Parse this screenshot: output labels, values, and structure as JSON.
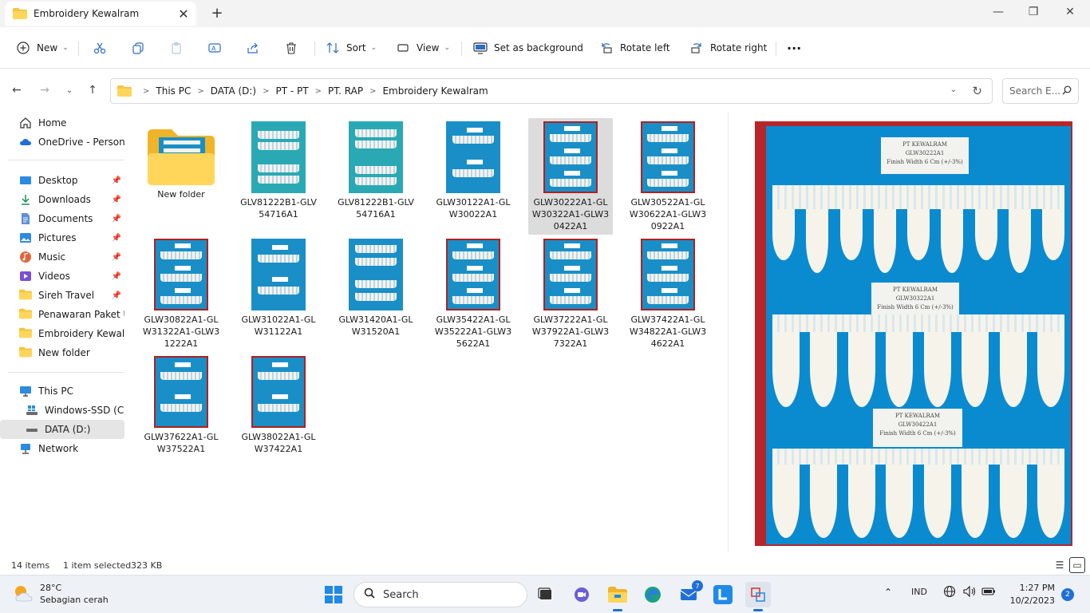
{
  "window": {
    "tab_title": "Embroidery Kewalram",
    "minimize": "—",
    "maximize": "❐",
    "close": "✕"
  },
  "toolbar": {
    "new_label": "New",
    "sort_label": "Sort",
    "view_label": "View",
    "set_background_label": "Set as background",
    "rotate_left_label": "Rotate left",
    "rotate_right_label": "Rotate right",
    "more_label": "···"
  },
  "address": {
    "crumbs": [
      "This PC",
      "DATA (D:)",
      "PT - PT",
      "PT. RAP",
      "Embroidery Kewalram"
    ],
    "search_placeholder": "Search E..."
  },
  "sidebar": {
    "items": [
      {
        "label": "Home"
      },
      {
        "label": "OneDrive - Personal"
      },
      {
        "label": "Desktop"
      },
      {
        "label": "Downloads"
      },
      {
        "label": "Documents"
      },
      {
        "label": "Pictures"
      },
      {
        "label": "Music"
      },
      {
        "label": "Videos"
      },
      {
        "label": "Sireh Travel"
      },
      {
        "label": "Penawaran Paket Um"
      },
      {
        "label": "Embroidery Kewalrar"
      },
      {
        "label": "New folder"
      },
      {
        "label": "This PC"
      },
      {
        "label": "Windows-SSD (C:)"
      },
      {
        "label": "DATA (D:)"
      },
      {
        "label": "Network"
      }
    ]
  },
  "files": [
    {
      "name": "New folder"
    },
    {
      "name": "GLV81222B1-GLV54716A1"
    },
    {
      "name": "GLV81222B1-GLV54716A1"
    },
    {
      "name": "GLW30122A1-GLW30022A1"
    },
    {
      "name": "GLW30222A1-GLW30322A1-GLW30422A1"
    },
    {
      "name": "GLW30522A1-GLW30622A1-GLW30922A1"
    },
    {
      "name": "GLW30822A1-GLW31322A1-GLW31222A1"
    },
    {
      "name": "GLW31022A1-GLW31122A1"
    },
    {
      "name": "GLW31420A1-GLW31520A1"
    },
    {
      "name": "GLW35422A1-GLW35222A1-GLW35622A1"
    },
    {
      "name": "GLW37222A1-GLW37922A1-GLW37322A1"
    },
    {
      "name": "GLW37422A1-GLW34822A1-GLW34622A1"
    },
    {
      "name": "GLW37622A1-GLW37522A1"
    },
    {
      "name": "GLW38022A1-GLW37422A1"
    }
  ],
  "preview": {
    "tags": [
      {
        "l1": "PT KEWALRAM",
        "l2": "GLW30222A1",
        "l3": "Finish Width 6 Cm (+/-3%)"
      },
      {
        "l1": "PT KEWALRAM",
        "l2": "GLW30322A1",
        "l3": "Finish Width 6 Cm (+/-3%)"
      },
      {
        "l1": "PT KEWALRAM",
        "l2": "GLW30422A1",
        "l3": "Finish Width 6 Cm (+/-3%)"
      }
    ]
  },
  "status": {
    "items_count": "14 items",
    "selected": "1 item selected",
    "size": "323 KB"
  },
  "taskbar": {
    "temp": "28°C",
    "weather": "Sebagian cerah",
    "search_label": "Search",
    "mail_badge": "7",
    "language": "IND",
    "time": "1:27 PM",
    "date": "10/2/2023",
    "notifications": "2"
  },
  "colors": {
    "accent": "#1f6fd6",
    "folder": "#f6c342",
    "lace_bg": "#0a8bd0",
    "frame": "#b8262a"
  }
}
